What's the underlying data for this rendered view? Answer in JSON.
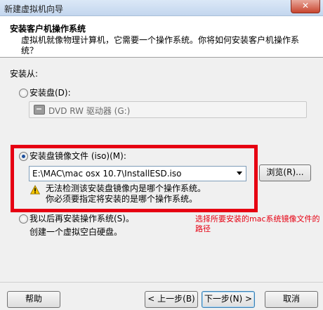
{
  "window": {
    "title": "新建虚拟机向导",
    "close_label": "✕"
  },
  "header": {
    "title": "安装客户机操作系统",
    "description": "虚拟机就像物理计算机，它需要一个操作系统。你将如何安装客户机操作系统？"
  },
  "install_from_label": "安装从:",
  "options": {
    "disc": {
      "label": "安装盘(D):",
      "checked": false
    },
    "drive": {
      "value": "DVD RW 驱动器 (G:)"
    },
    "iso": {
      "label": "安装盘镜像文件 (iso)(M):",
      "checked": true
    },
    "iso_path": {
      "value": "E:\\MAC\\mac osx 10.7\\InstallESD.iso"
    },
    "browse_label": "浏览(R)...",
    "warning_line1": "无法检测该安装盘镜像内是哪个操作系统。",
    "warning_line2": "你必须要指定将安装的是哪个操作系统。",
    "later": {
      "label": "我以后再安装操作系统(S)。",
      "checked": false
    },
    "later_desc": "创建一个虚拟空白硬盘。"
  },
  "annotation": "选择所要安装的mac系统镜像文件的路径",
  "footer": {
    "help_label": "帮助",
    "back_label": "< 上一步(B)",
    "next_label": "下一步(N) >",
    "cancel_label": "取消"
  },
  "colors": {
    "annotation_red": "#e60012",
    "header_bg": "#ffffff",
    "dialog_bg": "#f0f0f0"
  }
}
